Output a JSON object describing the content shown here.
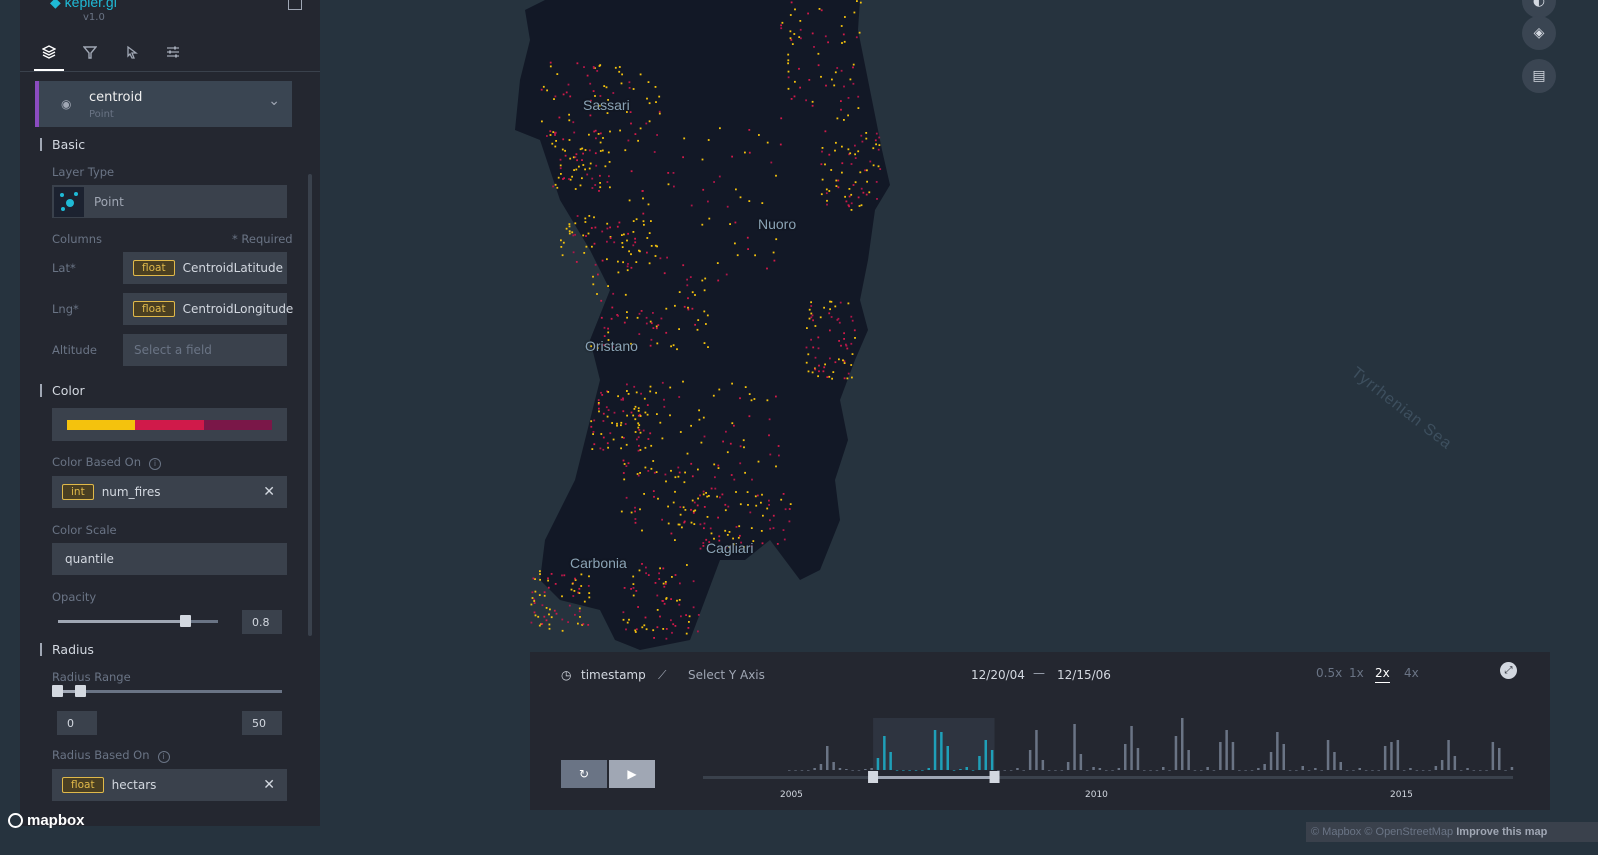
{
  "app": {
    "name": "kepler.gl",
    "version": "v1.0"
  },
  "tabs": [
    "layers",
    "filters",
    "interactions",
    "map-settings"
  ],
  "layer": {
    "name": "centroid",
    "type": "Point",
    "basic": {
      "section_title": "Basic",
      "layer_type_label": "Layer Type",
      "layer_type_value": "Point",
      "columns_label": "Columns",
      "required_note": "* Required",
      "lat_label": "Lat*",
      "lat_type": "float",
      "lat_field": "CentroidLatitude",
      "lng_label": "Lng*",
      "lng_type": "float",
      "lng_field": "CentroidLongitude",
      "altitude_label": "Altitude",
      "altitude_placeholder": "Select a field"
    },
    "color": {
      "section_title": "Color",
      "palette": [
        "#f4c20d",
        "#d01a4a",
        "#7a1748"
      ],
      "based_on_label": "Color Based On",
      "based_on_type": "int",
      "based_on_field": "num_fires",
      "scale_label": "Color Scale",
      "scale_value": "quantile",
      "opacity_label": "Opacity",
      "opacity_value": "0.8"
    },
    "radius": {
      "section_title": "Radius",
      "range_label": "Radius Range",
      "range_min": "0",
      "range_max": "50",
      "based_on_label": "Radius Based On",
      "based_on_type": "float",
      "based_on_field": "hectars"
    }
  },
  "map": {
    "cities": [
      "Sassari",
      "Nuoro",
      "Oristano",
      "Carbonia",
      "Cagliari"
    ],
    "sea_label": "Tyrrhenian Sea"
  },
  "timeline": {
    "field": "timestamp",
    "y_axis_placeholder": "Select Y Axis",
    "start": "12/20/04",
    "separator": "—",
    "end": "12/15/06",
    "speeds": [
      "0.5x",
      "1x",
      "2x",
      "4x"
    ],
    "selected_speed": "2x",
    "ticks": [
      "2005",
      "2010",
      "2015"
    ],
    "histogram": [
      0,
      0,
      0,
      0,
      2,
      6,
      24,
      8,
      2,
      1,
      0,
      0,
      1,
      2,
      12,
      34,
      18,
      0,
      0,
      0,
      0,
      0,
      2,
      40,
      38,
      24,
      0,
      1,
      3,
      0,
      14,
      30,
      20,
      0,
      0,
      0,
      2,
      0,
      20,
      40,
      10,
      0,
      0,
      0,
      8,
      46,
      16,
      0,
      3,
      2,
      0,
      0,
      2,
      26,
      44,
      22,
      0,
      0,
      0,
      3,
      0,
      34,
      52,
      20,
      0,
      0,
      3,
      0,
      28,
      40,
      28,
      0,
      0,
      0,
      2,
      6,
      18,
      38,
      26,
      0,
      0,
      4,
      0,
      2,
      0,
      30,
      18,
      8,
      0,
      0,
      2,
      0,
      0,
      0,
      24,
      28,
      30,
      0,
      2,
      0,
      0,
      0,
      4,
      10,
      30,
      14,
      0,
      2,
      0,
      0,
      0,
      28,
      22,
      0,
      3
    ],
    "window_start_frac": 0.105,
    "window_end_frac": 0.255
  },
  "attribution": {
    "mapbox_logo": "mapbox",
    "text": "© Mapbox © OpenStreetMap",
    "improve": "Improve this map"
  }
}
